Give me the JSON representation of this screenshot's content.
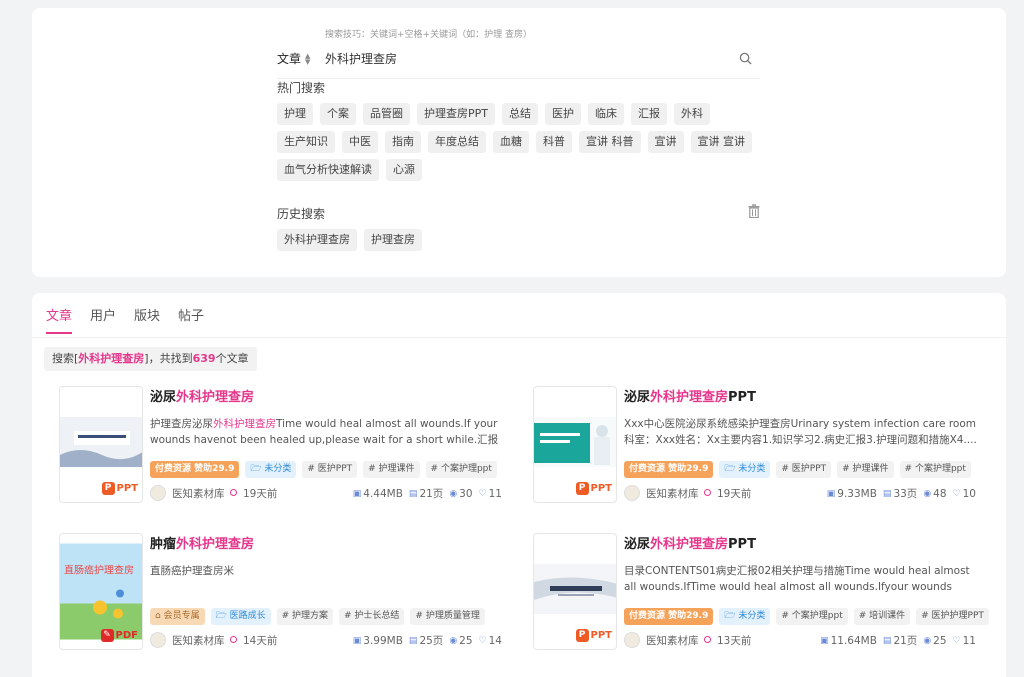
{
  "search": {
    "tip": "搜索技巧：关键词+空格+关键词（如：护理 查房）",
    "type_label": "文章",
    "value": "外科护理查房"
  },
  "hot": {
    "title": "热门搜索",
    "tags": [
      "护理",
      "个案",
      "品管圈",
      "护理查房PPT",
      "总结",
      "医护",
      "临床",
      "汇报",
      "外科",
      "生产知识",
      "中医",
      "指南",
      "年度总结",
      "血糖",
      "科普",
      "宣讲 科普",
      "宣讲",
      "宣讲 宣讲",
      "血气分析快速解读",
      "心源"
    ]
  },
  "history": {
    "title": "历史搜索",
    "tags": [
      "外科护理查房",
      "护理查房"
    ]
  },
  "results": {
    "tabs": [
      "文章",
      "用户",
      "版块",
      "帖子"
    ],
    "summary": {
      "prefix": "搜索[",
      "keyword": "外科护理查房",
      "middle": "]，共找到",
      "count": "639",
      "suffix": "个文章"
    },
    "keyword": "外科护理查房",
    "cards": [
      {
        "title_pre": "泌尿",
        "title_post": "",
        "desc_pre": "护理查房泌尿",
        "desc_post": "Time would heal almost all wounds.If your wounds havenot been healed up,please wait for a short while.汇报人：...",
        "desc_has_hl": true,
        "file_type": "PPT",
        "tags": [
          {
            "label": "付费资源 赞助29.9",
            "kind": "paid"
          },
          {
            "label": "🗁 未分类",
            "kind": "cat"
          },
          {
            "label": "# 医护PPT",
            "kind": "plain"
          },
          {
            "label": "# 护理课件",
            "kind": "plain"
          },
          {
            "label": "# 个案护理ppt",
            "kind": "plain"
          }
        ],
        "author": "医知素材库",
        "time": "19天前",
        "size": "4.44MB",
        "pages": "21页",
        "views": "30",
        "likes": "11"
      },
      {
        "title_pre": "泌尿",
        "title_post": "PPT",
        "desc_pre": "Xxx中心医院泌尿系统感染护理查房Urinary system infection care room科室：Xxx姓名：Xx主要内容1.知识学习2.病史汇报3.护理问题和措施X4....",
        "desc_post": "",
        "desc_has_hl": false,
        "file_type": "PPT",
        "tags": [
          {
            "label": "付费资源 赞助29.9",
            "kind": "paid"
          },
          {
            "label": "🗁 未分类",
            "kind": "cat"
          },
          {
            "label": "# 医护PPT",
            "kind": "plain"
          },
          {
            "label": "# 护理课件",
            "kind": "plain"
          },
          {
            "label": "# 个案护理ppt",
            "kind": "plain"
          }
        ],
        "author": "医知素材库",
        "time": "19天前",
        "size": "9.33MB",
        "pages": "33页",
        "views": "48",
        "likes": "10"
      },
      {
        "title_pre": "肿瘤",
        "title_post": "",
        "desc_pre": "直肠癌护理查房米",
        "desc_post": "",
        "desc_has_hl": false,
        "file_type": "PDF",
        "tags": [
          {
            "label": "⌂ 会员专属",
            "kind": "member"
          },
          {
            "label": "🗁 医路成长",
            "kind": "cat"
          },
          {
            "label": "# 护理方案",
            "kind": "plain"
          },
          {
            "label": "# 护士长总结",
            "kind": "plain"
          },
          {
            "label": "# 护理质量管理",
            "kind": "plain"
          }
        ],
        "author": "医知素材库",
        "time": "14天前",
        "size": "3.99MB",
        "pages": "25页",
        "views": "25",
        "likes": "14"
      },
      {
        "title_pre": "泌尿",
        "title_post": "PPT",
        "desc_pre": "目录CONTENTS01病史汇报02相关护理与措施Time would heal almost all wounds.IfTime would heal almost all wounds.Ifyour wounds have not...",
        "desc_post": "",
        "desc_has_hl": false,
        "file_type": "PPT",
        "tags": [
          {
            "label": "付费资源 赞助29.9",
            "kind": "paid"
          },
          {
            "label": "🗁 未分类",
            "kind": "cat"
          },
          {
            "label": "# 个案护理ppt",
            "kind": "plain"
          },
          {
            "label": "# 培训课件",
            "kind": "plain"
          },
          {
            "label": "# 医护护理PPT",
            "kind": "plain"
          }
        ],
        "author": "医知素材库",
        "time": "13天前",
        "size": "11.64MB",
        "pages": "21页",
        "views": "25",
        "likes": "11"
      }
    ]
  },
  "colors": {
    "accent": "#e5378c",
    "ppt": "#ef5b25",
    "pdf": "#e02a2a"
  }
}
